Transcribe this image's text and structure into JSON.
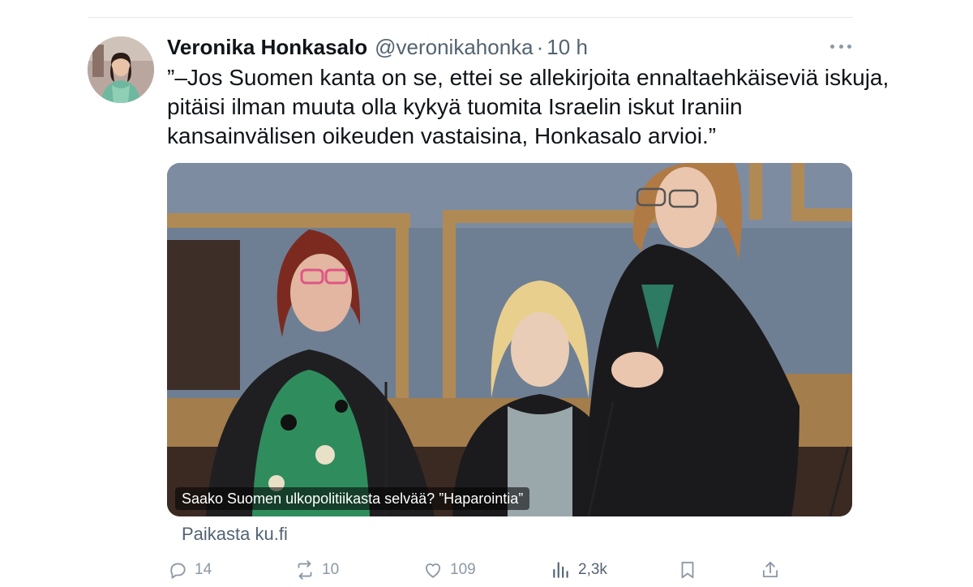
{
  "tweet": {
    "author": {
      "display_name": "Veronika Honkasalo",
      "handle": "@veronikahonka",
      "separator": "·",
      "time": "10 h"
    },
    "text_lines": [
      "”–Jos Suomen kanta on se, ettei se allekirjoita ennaltaehkäiseviä iskuja,",
      "pitäisi ilman muuta olla kykyä tuomita Israelin iskut Iraniin",
      "kansainvälisen oikeuden vastaisina, Honkasalo arvioi.”"
    ],
    "card": {
      "caption": "Saako Suomen ulkopolitiikasta selvää? ”Haparointia”",
      "source": "Paikasta ku.fi"
    },
    "actions": {
      "replies": "14",
      "reposts": "10",
      "likes": "109",
      "views": "2,3k"
    }
  },
  "icons": {
    "more": "more-horizontal-icon",
    "reply": "reply-icon",
    "repost": "repost-icon",
    "like": "heart-icon",
    "views": "views-chart-icon",
    "bookmark": "bookmark-icon",
    "share": "share-icon"
  },
  "colors": {
    "text_primary": "#0f1419",
    "text_secondary": "#536471",
    "icon_muted": "#8b98a5",
    "divider": "#e6e9ec"
  }
}
